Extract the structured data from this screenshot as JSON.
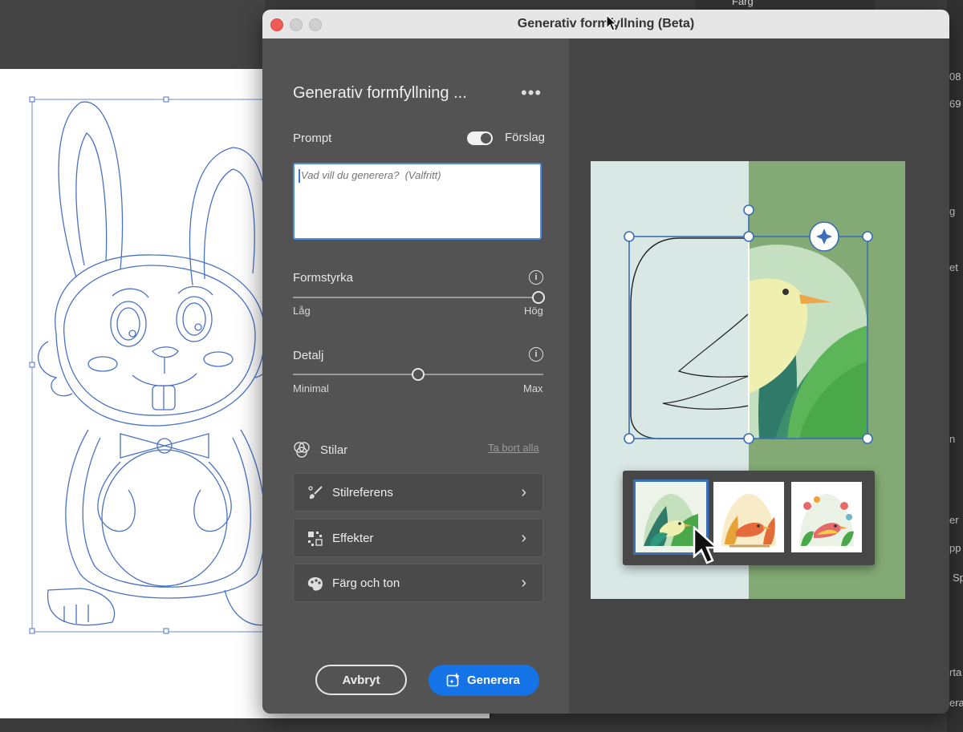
{
  "window": {
    "title": "Generativ formfyllning (Beta)"
  },
  "panel": {
    "heading": "Generativ formfyllning ...",
    "more_icon": "more-horizontal-icon",
    "prompt_label": "Prompt",
    "suggestions_label": "Förslag",
    "suggestions_toggle_on": true,
    "prompt_placeholder": "Vad vill du generera?  (Valfritt)",
    "prompt_value": ""
  },
  "sliders": {
    "shape_strength": {
      "label": "Formstyrka",
      "min_label": "Låg",
      "max_label": "Hög",
      "value": 1.0
    },
    "detail": {
      "label": "Detalj",
      "min_label": "Minimal",
      "max_label": "Max",
      "value": 0.5
    }
  },
  "styles": {
    "label": "Stilar",
    "clear_all": "Ta bort alla",
    "items": [
      {
        "label": "Stilreferens",
        "icon": "style-reference-icon"
      },
      {
        "label": "Effekter",
        "icon": "effects-icon"
      },
      {
        "label": "Färg och ton",
        "icon": "color-tone-icon"
      }
    ]
  },
  "buttons": {
    "cancel": "Avbryt",
    "generate": "Generera"
  },
  "background_app": {
    "top_label": "Färg",
    "side_values": [
      "08",
      "69",
      "g",
      "et",
      "n",
      "er",
      "pp",
      "Sp",
      "rta",
      "era"
    ]
  },
  "preview": {
    "variant_count": 3,
    "selected_variant": 0
  },
  "colors": {
    "accent": "#1473e6",
    "selection": "#3b6fb6",
    "panel_bg": "#535353",
    "illustration_left": "#d9e8e4",
    "illustration_right": "#83aa74"
  }
}
